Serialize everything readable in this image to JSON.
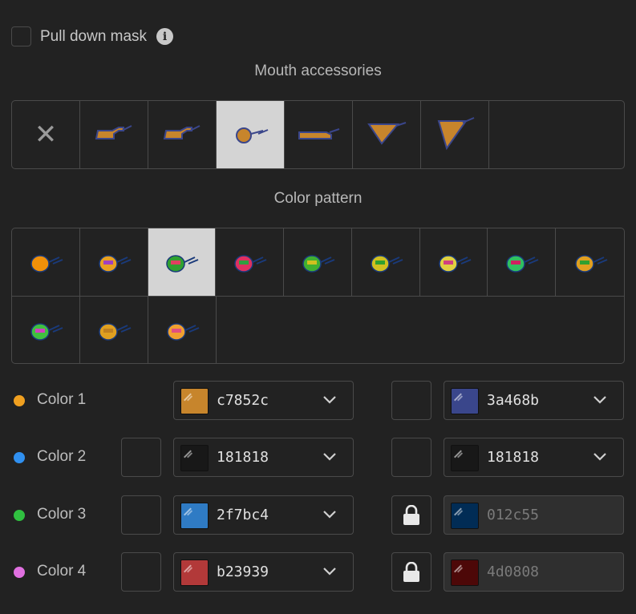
{
  "mask": {
    "label": "Pull down mask",
    "checked": false,
    "info_icon": "info-icon"
  },
  "mouth": {
    "title": "Mouth accessories",
    "none_symbol": "✕",
    "items": [
      {
        "kind": "none"
      },
      {
        "kind": "accessory",
        "icon": "pipe-icon"
      },
      {
        "kind": "accessory",
        "icon": "pipe-icon"
      },
      {
        "kind": "accessory",
        "icon": "round-pipe-icon",
        "selected": true
      },
      {
        "kind": "accessory",
        "icon": "long-pipe-icon"
      },
      {
        "kind": "accessory",
        "icon": "triangle-pipe-icon"
      },
      {
        "kind": "accessory",
        "icon": "large-triangle-pipe-icon"
      }
    ]
  },
  "pattern": {
    "title": "Color pattern",
    "items": [
      {
        "icon": "pattern-icon",
        "colors": [
          "#f0900a",
          "#f0900a"
        ]
      },
      {
        "icon": "pattern-icon",
        "colors": [
          "#e8a020",
          "#a040c0"
        ]
      },
      {
        "icon": "pattern-icon",
        "colors": [
          "#30a030",
          "#e04060"
        ],
        "selected": true
      },
      {
        "icon": "pattern-icon",
        "colors": [
          "#e03060",
          "#30a040"
        ]
      },
      {
        "icon": "pattern-icon",
        "colors": [
          "#40b030",
          "#d0c020"
        ]
      },
      {
        "icon": "pattern-icon",
        "colors": [
          "#d0c020",
          "#30a030"
        ]
      },
      {
        "icon": "pattern-icon",
        "colors": [
          "#e0d040",
          "#d04080"
        ]
      },
      {
        "icon": "pattern-icon",
        "colors": [
          "#30c060",
          "#d02060"
        ]
      },
      {
        "icon": "pattern-icon",
        "colors": [
          "#e0a020",
          "#30a030"
        ]
      },
      {
        "icon": "pattern-icon",
        "colors": [
          "#40c040",
          "#d040c0"
        ]
      },
      {
        "icon": "pattern-icon",
        "colors": [
          "#e0a020",
          "#c08020"
        ]
      },
      {
        "icon": "pattern-icon",
        "colors": [
          "#f0a030",
          "#e05080"
        ]
      }
    ]
  },
  "colors": [
    {
      "label": "Color 1",
      "dot": "#f0a020",
      "has_left_box": false,
      "primary": {
        "hex": "c7852c",
        "swatch": "#c7852c"
      },
      "right_control": "box",
      "secondary": {
        "hex": "3a468b",
        "swatch": "#3a468b",
        "disabled": false
      }
    },
    {
      "label": "Color 2",
      "dot": "#3090f0",
      "has_left_box": true,
      "primary": {
        "hex": "181818",
        "swatch": "#181818"
      },
      "right_control": "box",
      "secondary": {
        "hex": "181818",
        "swatch": "#181818",
        "disabled": false
      }
    },
    {
      "label": "Color 3",
      "dot": "#30c040",
      "has_left_box": true,
      "primary": {
        "hex": "2f7bc4",
        "swatch": "#2f7bc4"
      },
      "right_control": "lock-icon",
      "secondary": {
        "hex": "012c55",
        "swatch": "#012c55",
        "disabled": true
      }
    },
    {
      "label": "Color 4",
      "dot": "#e070e0",
      "has_left_box": true,
      "primary": {
        "hex": "b23939",
        "swatch": "#b23939"
      },
      "right_control": "lock-icon",
      "secondary": {
        "hex": "4d0808",
        "swatch": "#4d0808",
        "disabled": true
      }
    }
  ]
}
